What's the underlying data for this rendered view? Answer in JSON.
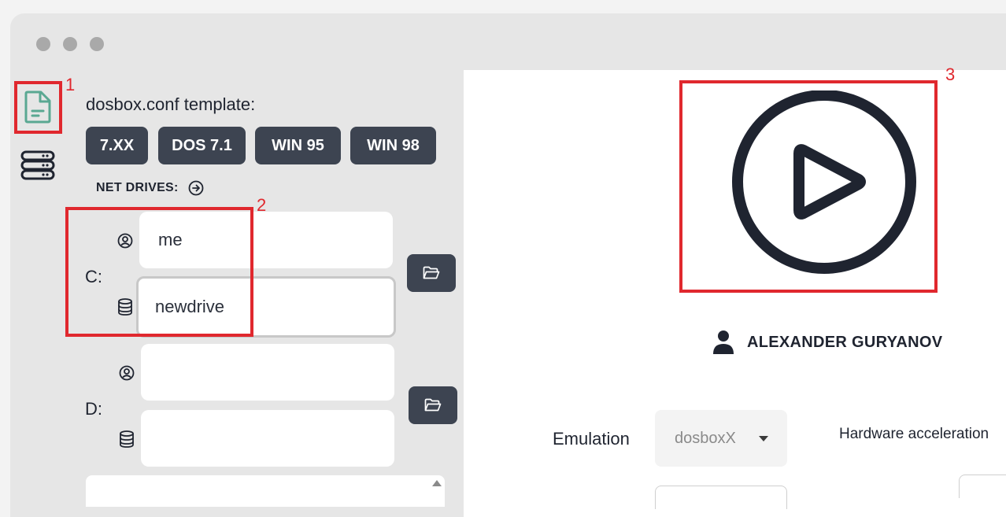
{
  "template": {
    "label": "dosbox.conf template:",
    "buttons": [
      "7.XX",
      "DOS 7.1",
      "WIN 95",
      "WIN 98"
    ]
  },
  "net_drives": {
    "label": "NET DRIVES:"
  },
  "drives": [
    {
      "letter": "C:",
      "user_value": "me",
      "drive_value": "newdrive"
    },
    {
      "letter": "D:",
      "user_value": "",
      "drive_value": ""
    }
  ],
  "annotations": [
    "1",
    "2",
    "3"
  ],
  "author": {
    "name": "ALEXANDER GURYANOV"
  },
  "emulation": {
    "label": "Emulation",
    "selected": "dosboxX"
  },
  "hardware": {
    "label": "Hardware acceleration"
  },
  "colors": {
    "accent_icon": "#5aa892",
    "button_bg": "#3d4451",
    "highlight": "#e0282e"
  }
}
